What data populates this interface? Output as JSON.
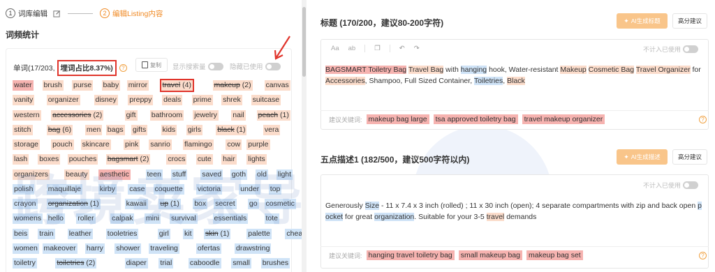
{
  "steps": [
    {
      "num": "1",
      "label": "词库编辑",
      "active": false
    },
    {
      "num": "2",
      "label": "编辑Listing内容",
      "active": true
    }
  ],
  "left": {
    "section_title": "词频统计",
    "words_label": "单词(17/203,",
    "ratio_label": "埋词占比8.37%)",
    "help": "?",
    "copy_label": "复制",
    "toggle_search": "显示搜索量",
    "toggle_used": "隐藏已使用",
    "tag_rows": [
      [
        [
          "water",
          "red",
          false
        ],
        [
          "brush",
          "orange",
          false
        ],
        [
          "purse",
          "orange",
          false
        ],
        [
          "baby",
          "orange",
          false
        ],
        [
          "mirror",
          "orange",
          false
        ],
        [
          "travel (4)",
          "orange",
          true,
          true
        ],
        [
          "makeup (2)",
          "orange",
          true
        ],
        [
          "canvas",
          "orange",
          false
        ]
      ],
      [
        [
          "vanity",
          "orange",
          false
        ],
        [
          "organizer",
          "orange",
          false
        ],
        [
          "disney",
          "orange",
          false
        ],
        [
          "preppy",
          "orange",
          false
        ],
        [
          "deals",
          "orange",
          false
        ],
        [
          "prime",
          "orange",
          false
        ],
        [
          "shrek",
          "orange",
          false
        ],
        [
          "suitcase",
          "orange",
          false
        ]
      ],
      [
        [
          "western",
          "orange",
          false
        ],
        [
          "accessories (2)",
          "orange",
          true
        ],
        [
          "gift",
          "orange",
          false
        ],
        [
          "bathroom",
          "orange",
          false
        ],
        [
          "jewelry",
          "orange",
          false
        ],
        [
          "nail",
          "orange",
          false
        ],
        [
          "peach (1)",
          "orange",
          true
        ]
      ],
      [
        [
          "stitch",
          "orange",
          false
        ],
        [
          "bag (6)",
          "orange",
          true
        ],
        [
          "men",
          "orange",
          false
        ],
        [
          "bags",
          "orange",
          false
        ],
        [
          "gifts",
          "orange",
          false
        ],
        [
          "kids",
          "orange",
          false
        ],
        [
          "girls",
          "orange",
          false
        ],
        [
          "black (1)",
          "orange",
          true
        ],
        [
          "vera",
          "orange",
          false
        ]
      ],
      [
        [
          "storage",
          "orange",
          false
        ],
        [
          "pouch",
          "orange",
          false
        ],
        [
          "skincare",
          "orange",
          false
        ],
        [
          "pink",
          "orange",
          false
        ],
        [
          "sanrio",
          "orange",
          false
        ],
        [
          "flamingo",
          "orange",
          false
        ],
        [
          "cow",
          "orange",
          false
        ],
        [
          "purple",
          "orange",
          false
        ]
      ],
      [
        [
          "lash",
          "orange",
          false
        ],
        [
          "boxes",
          "orange",
          false
        ],
        [
          "pouches",
          "orange",
          false
        ],
        [
          "bagsmart (2)",
          "orange",
          true
        ],
        [
          "crocs",
          "orange",
          false
        ],
        [
          "cute",
          "orange",
          false
        ],
        [
          "hair",
          "orange",
          false
        ],
        [
          "lights",
          "orange",
          false
        ]
      ],
      [
        [
          "organizers",
          "orange",
          false
        ],
        [
          "beauty",
          "orange",
          false
        ],
        [
          "aesthetic",
          "red",
          false
        ],
        [
          "teen",
          "blue",
          false
        ],
        [
          "stuff",
          "blue",
          false
        ],
        [
          "saved",
          "blue",
          false
        ],
        [
          "goth",
          "blue",
          false
        ],
        [
          "old",
          "blue",
          false
        ],
        [
          "light",
          "blue",
          false
        ]
      ],
      [
        [
          "polish",
          "blue",
          false
        ],
        [
          "maquillaje",
          "blue",
          false
        ],
        [
          "kirby",
          "blue",
          false
        ],
        [
          "case",
          "blue",
          false
        ],
        [
          "coquette",
          "blue",
          false
        ],
        [
          "victoria",
          "blue",
          false
        ],
        [
          "under",
          "blue",
          false
        ],
        [
          "top",
          "blue",
          false
        ]
      ],
      [
        [
          "crayon",
          "blue",
          false
        ],
        [
          "organization (1)",
          "blue",
          true
        ],
        [
          "kawaii",
          "blue",
          false
        ],
        [
          "up (1)",
          "blue",
          true
        ],
        [
          "box",
          "blue",
          false
        ],
        [
          "secret",
          "blue",
          false
        ],
        [
          "go",
          "blue",
          false
        ],
        [
          "cosmetic",
          "blue",
          false
        ]
      ],
      [
        [
          "womens",
          "blue",
          false
        ],
        [
          "hello",
          "blue",
          false
        ],
        [
          "roller",
          "blue",
          false
        ],
        [
          "calpak",
          "blue",
          false
        ],
        [
          "mini",
          "blue",
          false
        ],
        [
          "survival",
          "blue",
          false
        ],
        [
          "essentials",
          "blue",
          false
        ],
        [
          "tote",
          "blue",
          false
        ]
      ],
      [
        [
          "beis",
          "blue",
          false
        ],
        [
          "train",
          "blue",
          false
        ],
        [
          "leather",
          "blue",
          false
        ],
        [
          "tooletries",
          "blue",
          false
        ],
        [
          "girl",
          "blue",
          false
        ],
        [
          "kit",
          "blue",
          false
        ],
        [
          "skin (1)",
          "blue",
          true
        ],
        [
          "palette",
          "blue",
          false
        ],
        [
          "cheap",
          "blue",
          false
        ]
      ],
      [
        [
          "women",
          "blue",
          false
        ],
        [
          "makeover",
          "blue",
          false
        ],
        [
          "harry",
          "blue",
          false
        ],
        [
          "shower",
          "blue",
          false
        ],
        [
          "traveling",
          "blue",
          false
        ],
        [
          "ofertas",
          "blue",
          false
        ],
        [
          "drawstring",
          "blue",
          false
        ]
      ],
      [
        [
          "toiletry",
          "blue",
          false
        ],
        [
          "toiletries (2)",
          "blue",
          true
        ],
        [
          "diaper",
          "blue",
          false
        ],
        [
          "trial",
          "blue",
          false
        ],
        [
          "caboodle",
          "blue",
          false
        ],
        [
          "small",
          "blue",
          false
        ],
        [
          "brushes",
          "blue",
          false
        ]
      ]
    ]
  },
  "right": {
    "title_section": {
      "title": "标题 (170/200，建议80-200字符)",
      "ai_button": "AI生成标题",
      "high_button": "高分建议",
      "toolbar": [
        "Aa",
        "ab"
      ],
      "exclude_label": "不计入已使用",
      "segments": [
        [
          "BAGSMART Toiletry Bag",
          "r"
        ],
        [
          " ",
          ""
        ],
        [
          "Travel Bag",
          "o"
        ],
        [
          " with ",
          ""
        ],
        [
          "hanging",
          "b"
        ],
        [
          " hook, Water-resistant ",
          ""
        ],
        [
          "Makeup",
          "o"
        ],
        [
          " ",
          ""
        ],
        [
          "Cosmetic Bag",
          "o"
        ],
        [
          " ",
          ""
        ],
        [
          "Travel Organizer",
          "o"
        ],
        [
          " for ",
          ""
        ],
        [
          "Accessories",
          "o"
        ],
        [
          ", Shampoo, Full Sized Container, ",
          ""
        ],
        [
          "Toiletries",
          "b"
        ],
        [
          ", ",
          ""
        ],
        [
          "Black",
          "o"
        ]
      ],
      "kw_label": "建议关键词:",
      "keywords": [
        "makeup bag large",
        "tsa approved toiletry bag",
        "travel makeup organizer"
      ]
    },
    "bullet_section": {
      "title": "五点描述1 (182/500，建议500字符以内)",
      "ai_button": "AI生成描述",
      "high_button": "高分建议",
      "exclude_label": "不计入已使用",
      "segments": [
        [
          "Generously ",
          ""
        ],
        [
          "Size",
          "b"
        ],
        [
          " - 11 x 7.4 x 3 inch (rolled) ; 11 x 30 inch (open); 4 separate compartments with zip and back open ",
          ""
        ],
        [
          "pocket",
          "b"
        ],
        [
          " for great ",
          ""
        ],
        [
          "organization",
          "b"
        ],
        [
          ". Suitable for your 3-5 ",
          ""
        ],
        [
          "travel",
          "o"
        ],
        [
          " demands",
          ""
        ]
      ],
      "kw_label": "建议关键词:",
      "keywords": [
        "hanging travel toiletry bag",
        "small makeup bag",
        "makeup bag set"
      ]
    }
  },
  "icons": {
    "edit": "pencil-square-icon",
    "copy": "copy-icon",
    "undo": "undo-icon",
    "redo": "redo-icon",
    "ai": "sparkle-icon",
    "help": "question-circle-icon"
  },
  "colors": {
    "accent": "#f08a24",
    "orange_tag": "#fbdccb",
    "red_tag": "#f6b3b0",
    "blue_tag": "#cfe3f7",
    "alert_red": "#e0342b",
    "ai_button": "#f9c58a"
  },
  "watermark": "跨境卖家导航"
}
